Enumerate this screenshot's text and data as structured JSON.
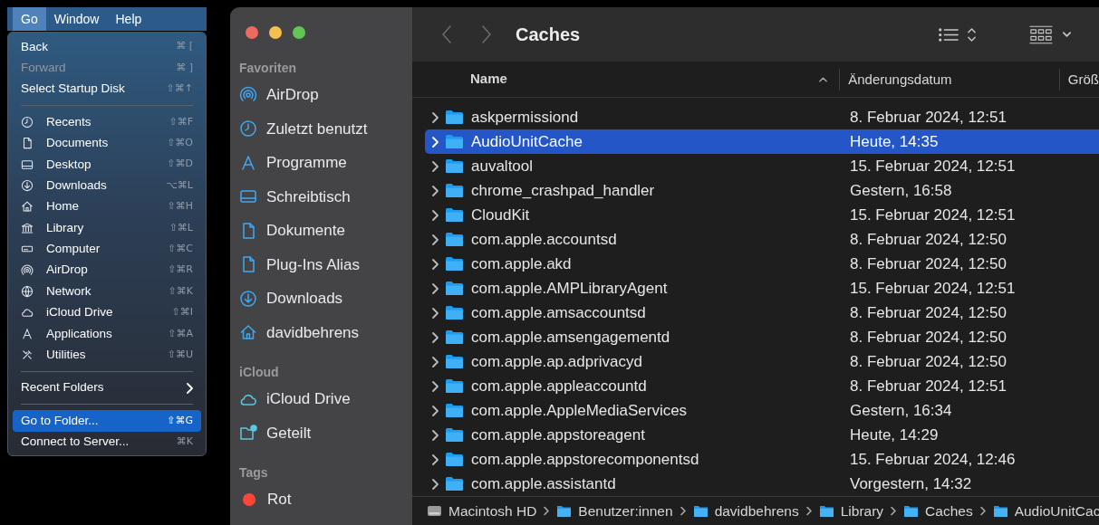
{
  "menubar": [
    {
      "label": "Go",
      "selected": true
    },
    {
      "label": "Window",
      "selected": false
    },
    {
      "label": "Help",
      "selected": false
    }
  ],
  "menu": {
    "sections": [
      {
        "items": [
          {
            "label": "Back",
            "shortcut": "⌘ [",
            "disabled": false,
            "selected": false
          },
          {
            "label": "Forward",
            "shortcut": "⌘ ]",
            "disabled": true,
            "selected": false
          },
          {
            "label": "Select Startup Disk",
            "shortcut": "⇧⌘↑",
            "disabled": false,
            "selected": false
          }
        ]
      },
      {
        "items": [
          {
            "label": "Recents",
            "shortcut": "⇧⌘F",
            "disabled": false,
            "selected": false
          },
          {
            "label": "Documents",
            "shortcut": "⇧⌘O",
            "disabled": false,
            "selected": false
          },
          {
            "label": "Desktop",
            "shortcut": "⇧⌘D",
            "disabled": false,
            "selected": false
          },
          {
            "label": "Downloads",
            "shortcut": "⌥⌘L",
            "disabled": false,
            "selected": false
          },
          {
            "label": "Home",
            "shortcut": "⇧⌘H",
            "disabled": false,
            "selected": false
          },
          {
            "label": "Library",
            "shortcut": "⇧⌘L",
            "disabled": false,
            "selected": false
          },
          {
            "label": "Computer",
            "shortcut": "⇧⌘C",
            "disabled": false,
            "selected": false
          },
          {
            "label": "AirDrop",
            "shortcut": "⇧⌘R",
            "disabled": false,
            "selected": false
          },
          {
            "label": "Network",
            "shortcut": "⇧⌘K",
            "disabled": false,
            "selected": false
          },
          {
            "label": "iCloud Drive",
            "shortcut": "⇧⌘I",
            "disabled": false,
            "selected": false
          },
          {
            "label": "Applications",
            "shortcut": "⇧⌘A",
            "disabled": false,
            "selected": false
          },
          {
            "label": "Utilities",
            "shortcut": "⇧⌘U",
            "disabled": false,
            "selected": false
          }
        ]
      },
      {
        "items": [
          {
            "label": "Recent Folders",
            "submenu": true,
            "disabled": false,
            "selected": false
          }
        ]
      },
      {
        "items": [
          {
            "label": "Go to Folder...",
            "shortcut": "⇧⌘G",
            "disabled": false,
            "selected": true
          },
          {
            "label": "Connect to Server...",
            "shortcut": "⌘K",
            "disabled": false,
            "selected": false
          }
        ]
      }
    ]
  },
  "window": {
    "title": "Caches"
  },
  "sidebar": {
    "sections": [
      {
        "heading": "Favoriten",
        "items": [
          {
            "label": "AirDrop"
          },
          {
            "label": "Zuletzt benutzt"
          },
          {
            "label": "Programme"
          },
          {
            "label": "Schreibtisch"
          },
          {
            "label": "Dokumente"
          },
          {
            "label": "Plug-Ins Alias"
          },
          {
            "label": "Downloads"
          },
          {
            "label": "davidbehrens"
          }
        ]
      },
      {
        "heading": "iCloud",
        "items": [
          {
            "label": "iCloud Drive"
          },
          {
            "label": "Geteilt"
          }
        ]
      },
      {
        "heading": "Tags",
        "items": [
          {
            "label": "Rot",
            "color": "#ff453a"
          }
        ]
      }
    ]
  },
  "table": {
    "columns": [
      "Name",
      "Änderungsdatum",
      "Größ"
    ],
    "rows": [
      {
        "name": "askpermissiond",
        "date": "8. Februar 2024, 12:51",
        "selected": false
      },
      {
        "name": "AudioUnitCache",
        "date": "Heute, 14:35",
        "selected": true
      },
      {
        "name": "auvaltool",
        "date": "15. Februar 2024, 12:51",
        "selected": false
      },
      {
        "name": "chrome_crashpad_handler",
        "date": "Gestern, 16:58",
        "selected": false
      },
      {
        "name": "CloudKit",
        "date": "15. Februar 2024, 12:51",
        "selected": false
      },
      {
        "name": "com.apple.accountsd",
        "date": "8. Februar 2024, 12:50",
        "selected": false
      },
      {
        "name": "com.apple.akd",
        "date": "8. Februar 2024, 12:50",
        "selected": false
      },
      {
        "name": "com.apple.AMPLibraryAgent",
        "date": "15. Februar 2024, 12:51",
        "selected": false
      },
      {
        "name": "com.apple.amsaccountsd",
        "date": "8. Februar 2024, 12:50",
        "selected": false
      },
      {
        "name": "com.apple.amsengagementd",
        "date": "8. Februar 2024, 12:50",
        "selected": false
      },
      {
        "name": "com.apple.ap.adprivacyd",
        "date": "8. Februar 2024, 12:50",
        "selected": false
      },
      {
        "name": "com.apple.appleaccountd",
        "date": "8. Februar 2024, 12:51",
        "selected": false
      },
      {
        "name": "com.apple.AppleMediaServices",
        "date": "Gestern, 16:34",
        "selected": false
      },
      {
        "name": "com.apple.appstoreagent",
        "date": "Heute, 14:29",
        "selected": false
      },
      {
        "name": "com.apple.appstorecomponentsd",
        "date": "15. Februar 2024, 12:46",
        "selected": false
      },
      {
        "name": "com.apple.assistantd",
        "date": "Vorgestern, 14:32",
        "selected": false
      }
    ]
  },
  "path_bar": [
    {
      "label": "Macintosh HD",
      "kind": "disk"
    },
    {
      "label": "Benutzer:innen",
      "kind": "folder"
    },
    {
      "label": "davidbehrens",
      "kind": "folder"
    },
    {
      "label": "Library",
      "kind": "folder"
    },
    {
      "label": "Caches",
      "kind": "folder"
    },
    {
      "label": "AudioUnitCac",
      "kind": "folder"
    }
  ]
}
